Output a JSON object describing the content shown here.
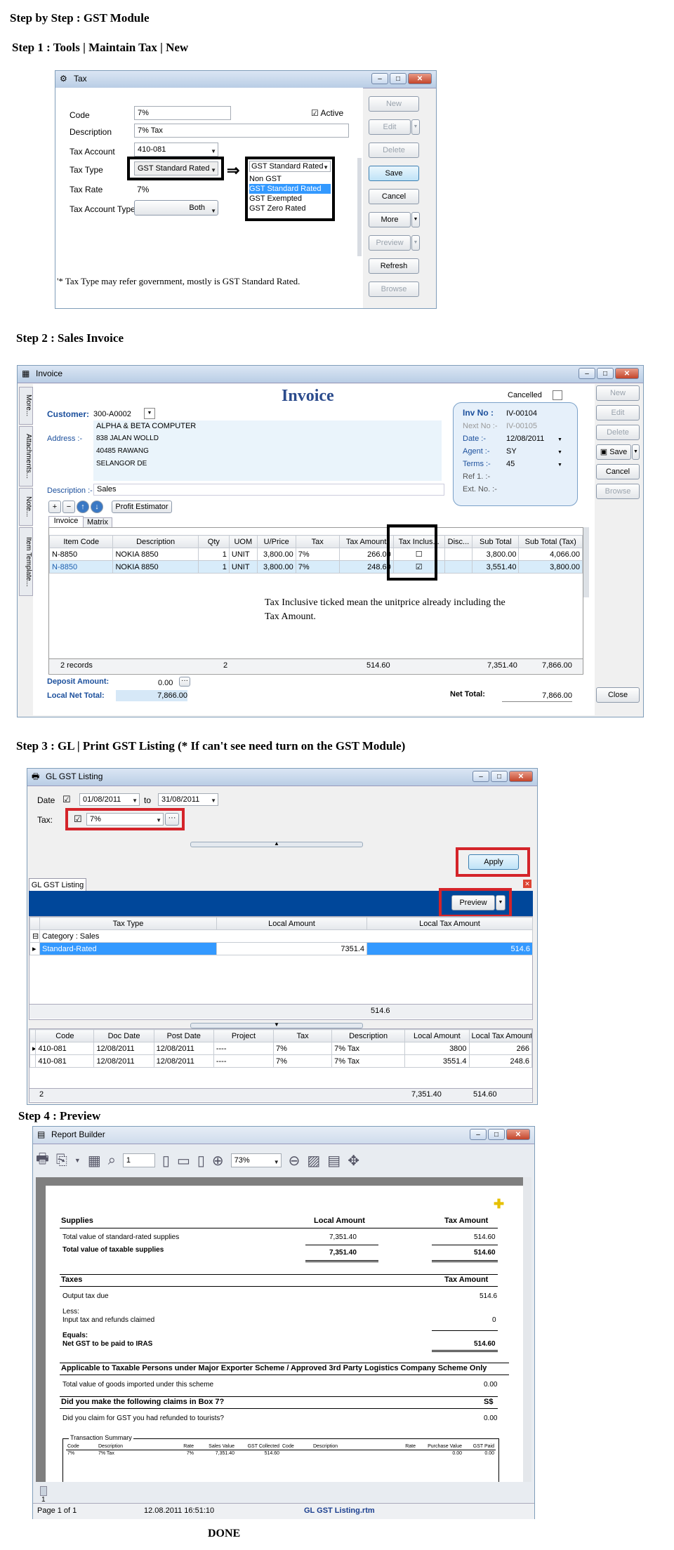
{
  "page_title": "Step by Step : GST Module",
  "step1": {
    "heading": "Step 1 : Tools | Maintain Tax | New",
    "window_title": "Tax",
    "labels": {
      "code": "Code",
      "description": "Description",
      "tax_account": "Tax Account",
      "tax_type": "Tax Type",
      "tax_rate": "Tax Rate",
      "tax_account_type": "Tax Account Type",
      "active": "Active"
    },
    "values": {
      "code": "7%",
      "description": "7% Tax",
      "tax_account": "410-081",
      "tax_type": "GST Standard Rated",
      "tax_rate": "7%",
      "tax_account_type": "Both"
    },
    "dropdown_selected": "GST Standard Rated",
    "dropdown_options": [
      "Non GST",
      "GST Standard Rated",
      "GST Exempted",
      "GST Zero Rated"
    ],
    "buttons": {
      "new": "New",
      "edit": "Edit",
      "delete": "Delete",
      "save": "Save",
      "cancel": "Cancel",
      "more": "More",
      "preview": "Preview",
      "refresh": "Refresh",
      "browse": "Browse"
    },
    "note": "'* Tax Type may refer government, mostly is GST Standard Rated."
  },
  "step2": {
    "heading": "Step 2 : Sales Invoice",
    "window_title": "Invoice",
    "side_tabs": [
      "More...",
      "Attachments...",
      "Note...",
      "Item Template..."
    ],
    "form_title": "Invoice",
    "cancelled_label": "Cancelled",
    "customer_label": "Customer:",
    "customer_code": "300-A0002",
    "address_label": "Address :-",
    "customer_name": "ALPHA & BETA COMPUTER",
    "address_lines": [
      "838 JALAN WOLLD",
      "40485 RAWANG",
      "SELANGOR DE"
    ],
    "description_label": "Description :-",
    "description_value": "Sales",
    "profit_estimator": "Profit Estimator",
    "tabs": [
      "Invoice",
      "Matrix"
    ],
    "info": {
      "inv_no_label": "Inv No :",
      "inv_no": "IV-00104",
      "next_no_label": "Next No :-",
      "next_no": "IV-00105",
      "date_label": "Date :-",
      "date": "12/08/2011",
      "agent_label": "Agent :-",
      "agent": "SY",
      "terms_label": "Terms :-",
      "terms": "45",
      "ref_label": "Ref 1. :-",
      "ext_label": "Ext. No. :-"
    },
    "columns": [
      "Item Code",
      "Description",
      "Qty",
      "UOM",
      "U/Price",
      "Tax",
      "Tax Amount",
      "Tax Inclus...",
      "Disc...",
      "Sub Total",
      "Sub Total (Tax)"
    ],
    "rows": [
      [
        "N-8850",
        "NOKIA 8850",
        "1",
        "UNIT",
        "3,800.00",
        "7%",
        "266.00",
        "",
        "",
        "3,800.00",
        "4,066.00"
      ],
      [
        "N-8850",
        "NOKIA 8850",
        "1",
        "UNIT",
        "3,800.00",
        "7%",
        "248.60",
        "",
        "",
        "3,551.40",
        "3,800.00"
      ]
    ],
    "note_line1": "Tax Inclusive ticked mean the unitprice already including the",
    "note_line2": "Tax Amount.",
    "footer": {
      "records": "2 records",
      "qty": "2",
      "tax_amount": "514.60",
      "sub_total": "7,351.40",
      "sub_total_tax": "7,866.00"
    },
    "deposit_label": "Deposit Amount:",
    "deposit_value": "0.00",
    "local_net_label": "Local Net Total:",
    "local_net_value": "7,866.00",
    "net_total_label": "Net Total:",
    "net_total_value": "7,866.00",
    "buttons": {
      "new": "New",
      "edit": "Edit",
      "delete": "Delete",
      "save": "Save",
      "cancel": "Cancel",
      "browse": "Browse",
      "close": "Close"
    }
  },
  "step3": {
    "heading": "Step 3 : GL | Print GST Listing  (* If can't see need turn on the GST Module)",
    "window_title": "GL GST Listing",
    "date_label": "Date",
    "date_from": "01/08/2011",
    "to_label": "to",
    "date_to": "31/08/2011",
    "tax_label": "Tax:",
    "tax_value": "7%",
    "apply": "Apply",
    "tab": "GL GST Listing",
    "preview": "Preview",
    "summary_columns": [
      "Tax Type",
      "Local Amount",
      "Local Tax Amount"
    ],
    "category": "Category : Sales",
    "summary_row": [
      "Standard-Rated",
      "7351.4",
      "514.6"
    ],
    "summary_total": "514.6",
    "detail_columns": [
      "Code",
      "Doc Date",
      "Post Date",
      "Project",
      "Tax",
      "Description",
      "Local Amount",
      "Local Tax Amount"
    ],
    "detail_rows": [
      [
        "410-081",
        "12/08/2011",
        "12/08/2011",
        "----",
        "7%",
        "7% Tax",
        "3800",
        "266"
      ],
      [
        "410-081",
        "12/08/2011",
        "12/08/2011",
        "----",
        "7%",
        "7% Tax",
        "3551.4",
        "248.6"
      ]
    ],
    "detail_footer": {
      "count": "2",
      "local_amount": "7,351.40",
      "tax_amount": "514.60"
    }
  },
  "step4": {
    "heading": "Step 4 : Preview",
    "window_title": "Report Builder",
    "page_field": "1",
    "zoom": "73%",
    "report": {
      "supplies": "Supplies",
      "local_amount": "Local Amount",
      "tax_amount": "Tax Amount",
      "std_rated": "Total value of standard-rated supplies",
      "std_local": "7,351.40",
      "std_tax": "514.60",
      "taxable": "Total value of taxable supplies",
      "taxable_local": "7,351.40",
      "taxable_tax": "514.60",
      "taxes": "Taxes",
      "taxes_col": "Tax Amount",
      "output_tax": "Output tax due",
      "output_value": "514.6",
      "less": "Less:",
      "input_tax": "Input tax and refunds claimed",
      "input_value": "0",
      "equals": "Equals:",
      "net_gst": "Net GST to be paid to IRAS",
      "net_value": "514.60",
      "major_exporter": "Applicable to Taxable Persons under Major Exporter Scheme / Approved 3rd Party Logistics Company Scheme Only",
      "imported": "Total value of goods imported under this scheme",
      "imported_value": "0.00",
      "box7": "Did you make the following claims in Box 7?",
      "currency": "S$",
      "tourists": "Did you claim for GST you had refunded to tourists?",
      "tourists_value": "0.00",
      "transaction_summary": "Transaction Summary",
      "ts_cols": [
        "Code",
        "Description",
        "Rate",
        "Sales Value",
        "GST Collected",
        "Code",
        "Description",
        "Rate",
        "Purchase Value",
        "GST Paid"
      ],
      "ts_row": [
        "7%",
        "7% Tax",
        "7%",
        "7,351.40",
        "514.60",
        "",
        "",
        "",
        "0.00",
        "0.00"
      ]
    },
    "page_indicator": "1",
    "status_page": "Page 1 of 1",
    "status_time": "12.08.2011 16:51:10",
    "status_file": "GL GST Listing.rtm"
  },
  "done": "DONE"
}
